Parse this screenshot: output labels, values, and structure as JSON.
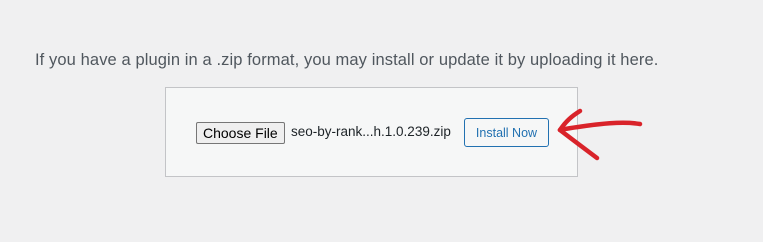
{
  "intro_text": "If you have a plugin in a .zip format, you may install or update it by uploading it here.",
  "upload": {
    "choose_file_label": "Choose File",
    "file_name": "seo-by-rank...h.1.0.239.zip",
    "install_button_label": "Install Now"
  },
  "colors": {
    "page_background": "#f0f0f1",
    "box_background": "#f6f7f7",
    "accent": "#2271b1",
    "annotation_arrow": "#d9232a"
  },
  "annotation": {
    "icon": "red-hand-drawn-arrow-icon"
  }
}
